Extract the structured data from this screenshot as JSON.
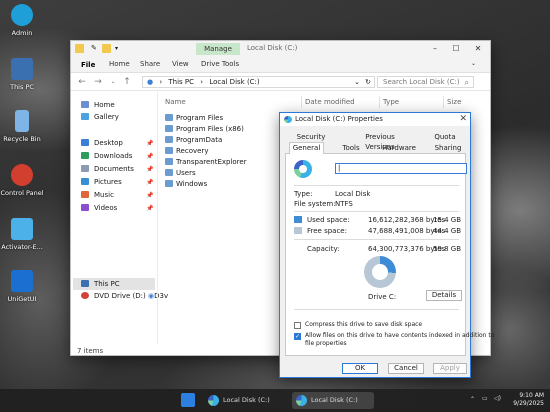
{
  "desktop": {
    "icons": [
      {
        "label": "Admin",
        "color": "#1f9fd8"
      },
      {
        "label": "This PC",
        "color": "#3a6fb0"
      },
      {
        "label": "Recycle Bin",
        "color": "#7fb5e6"
      },
      {
        "label": "Control Panel",
        "color": "#d23f2f"
      },
      {
        "label": "Activator-E...",
        "color": "#4cb1e8"
      },
      {
        "label": "UniGetUI",
        "color": "#1b6fd0"
      }
    ]
  },
  "explorer": {
    "ribbon_context_tab": "Manage",
    "window_title": "Local Disk (C:)",
    "ribbon_tabs": [
      "File",
      "Home",
      "Share",
      "View",
      "Drive Tools"
    ],
    "address": {
      "crumbs": [
        "This PC",
        "Local Disk (C:)"
      ]
    },
    "search_placeholder": "Search Local Disk (C:)",
    "sidebar": {
      "home": "Home",
      "gallery": "Gallery",
      "quick_access": [
        "Desktop",
        "Downloads",
        "Documents",
        "Pictures",
        "Music",
        "Videos"
      ],
      "this_pc": "This PC",
      "dvd": "DVD Drive (D:) ",
      "dvd_suffix": "D3v"
    },
    "columns": {
      "name": "Name",
      "date": "Date modified",
      "type": "Type",
      "size": "Size"
    },
    "files": [
      "Program Files",
      "Program Files (x86)",
      "ProgramData",
      "Recovery",
      "TransparentExplorer",
      "Users",
      "Windows"
    ],
    "status": "7 items"
  },
  "properties": {
    "title": "Local Disk (C:) Properties",
    "tabs_row1": [
      "Security",
      "Previous Versions",
      "Quota"
    ],
    "tabs_row2": [
      "General",
      "Tools",
      "Hardware",
      "Sharing"
    ],
    "name_value": "",
    "type_label": "Type:",
    "type_value": "Local Disk",
    "fs_label": "File system:",
    "fs_value": "NTFS",
    "used_label": "Used space:",
    "used_bytes": "16,612,282,368 bytes",
    "used_gb": "15.4 GB",
    "used_color": "#3e8cd6",
    "free_label": "Free space:",
    "free_bytes": "47,688,491,008 bytes",
    "free_gb": "44.4 GB",
    "free_color": "#b7c7d6",
    "capacity_label": "Capacity:",
    "capacity_bytes": "64,300,773,376 bytes",
    "capacity_gb": "59.8 GB",
    "used_fraction": 0.26,
    "drive_label": "Drive C:",
    "details_button": "Details",
    "compress_label": "Compress this drive to save disk space",
    "compress_checked": false,
    "index_label_1": "Allow files on this drive to have contents indexed in addition to",
    "index_label_2": "file properties",
    "index_checked": true,
    "ok": "OK",
    "cancel": "Cancel",
    "apply": "Apply"
  },
  "taskbar": {
    "apps": [
      "Local Disk (C:)",
      "Local Disk (C:) Prop..."
    ],
    "clock_time": "9:10 AM",
    "clock_date": "9/29/2025"
  }
}
